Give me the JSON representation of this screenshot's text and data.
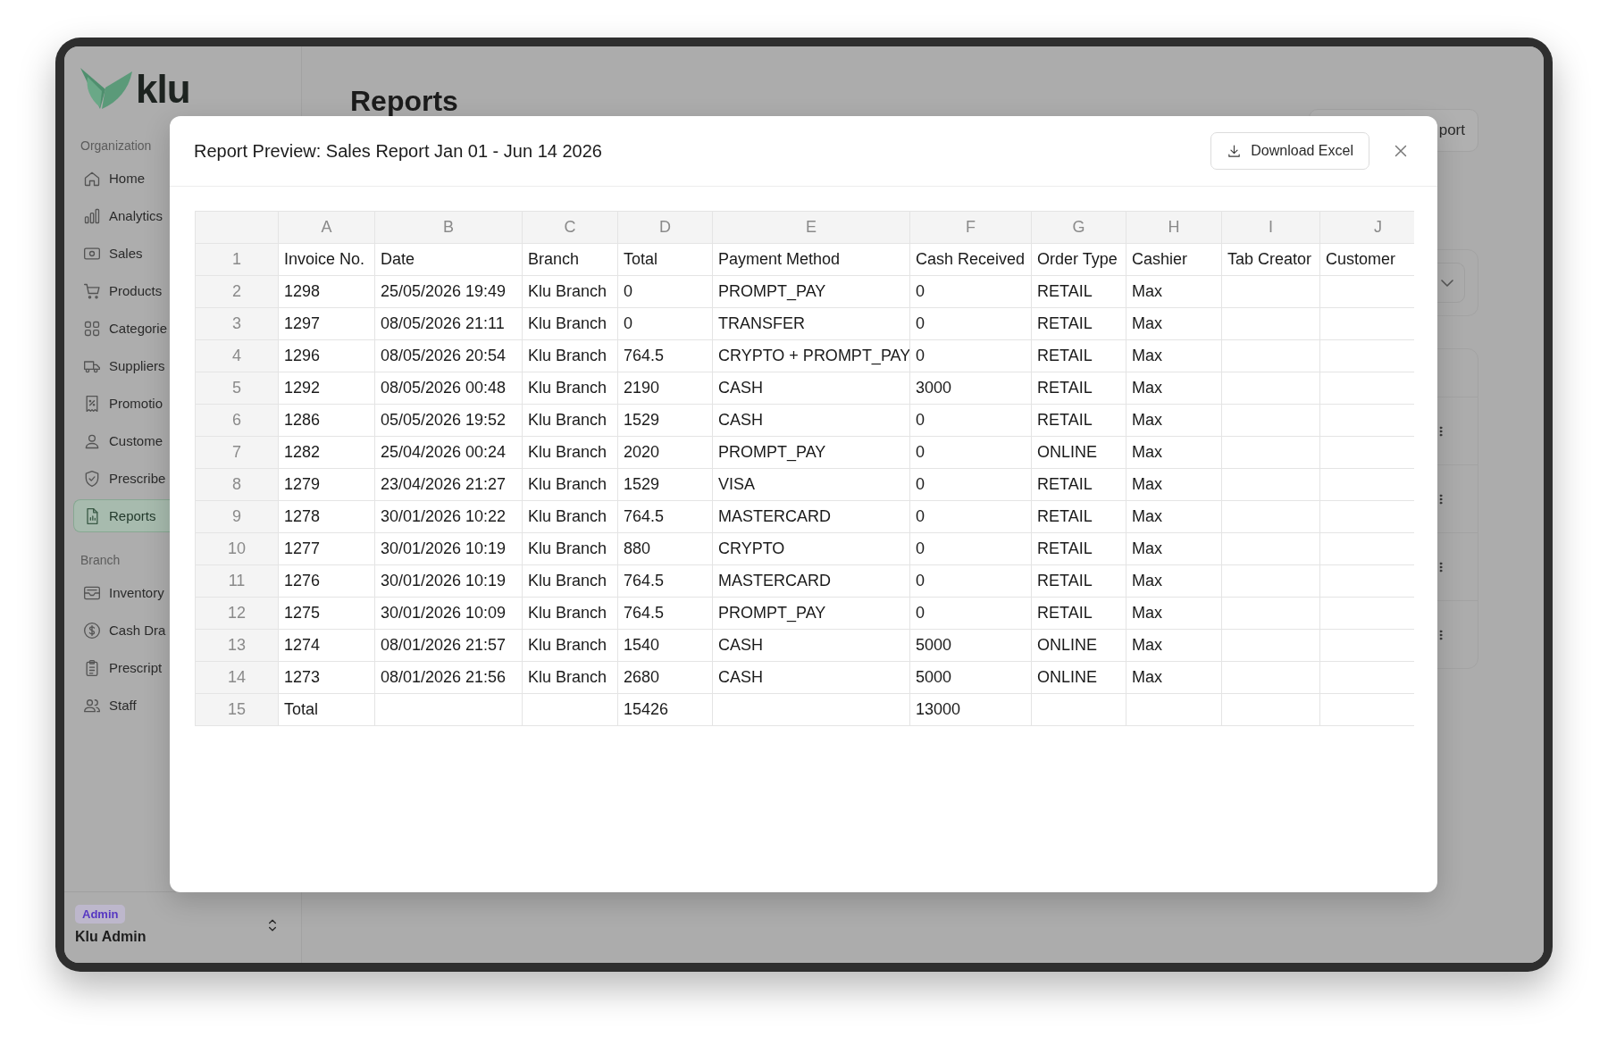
{
  "sidebar": {
    "logo": "klu",
    "sections": [
      {
        "heading": "Organization",
        "items": [
          {
            "label": "Home",
            "selected": false
          },
          {
            "label": "Analytics",
            "selected": false
          },
          {
            "label": "Sales",
            "selected": false
          },
          {
            "label": "Products",
            "selected": false
          },
          {
            "label": "Categorie",
            "selected": false
          },
          {
            "label": "Suppliers",
            "selected": false
          },
          {
            "label": "Promotio",
            "selected": false
          },
          {
            "label": "Custome",
            "selected": false
          },
          {
            "label": "Prescribe",
            "selected": false
          },
          {
            "label": "Reports",
            "selected": true
          }
        ]
      },
      {
        "heading": "Branch",
        "items": [
          {
            "label": "Inventory",
            "selected": false
          },
          {
            "label": "Cash Dra",
            "selected": false
          },
          {
            "label": "Prescript",
            "selected": false
          },
          {
            "label": "Staff",
            "selected": false
          }
        ]
      }
    ],
    "user": {
      "role": "Admin",
      "name": "Klu Admin"
    }
  },
  "page": {
    "title": "Reports",
    "action_button": "port"
  },
  "modal": {
    "title": "Report Preview: Sales Report Jan 01 - Jun 14 2026",
    "download_button": "Download Excel",
    "sheet": {
      "columns": [
        "A",
        "B",
        "C",
        "D",
        "E",
        "F",
        "G",
        "H",
        "I",
        "J"
      ],
      "rows": [
        {
          "number": "1",
          "cells": [
            "Invoice No.",
            "Date",
            "Branch",
            "Total",
            "Payment Method",
            "Cash Received",
            "Order Type",
            "Cashier",
            "Tab Creator",
            "Customer"
          ]
        },
        {
          "number": "2",
          "cells": [
            "1298",
            "25/05/2026 19:49",
            "Klu Branch",
            "0",
            "PROMPT_PAY",
            "0",
            "RETAIL",
            "Max"
          ]
        },
        {
          "number": "3",
          "cells": [
            "1297",
            "08/05/2026 21:11",
            "Klu Branch",
            "0",
            "TRANSFER",
            "0",
            "RETAIL",
            "Max"
          ]
        },
        {
          "number": "4",
          "cells": [
            "1296",
            "08/05/2026 20:54",
            "Klu Branch",
            "764.5",
            "CRYPTO + PROMPT_PAY",
            "0",
            "RETAIL",
            "Max"
          ]
        },
        {
          "number": "5",
          "cells": [
            "1292",
            "08/05/2026 00:48",
            "Klu Branch",
            "2190",
            "CASH",
            "3000",
            "RETAIL",
            "Max"
          ]
        },
        {
          "number": "6",
          "cells": [
            "1286",
            "05/05/2026 19:52",
            "Klu Branch",
            "1529",
            "CASH",
            "0",
            "RETAIL",
            "Max"
          ]
        },
        {
          "number": "7",
          "cells": [
            "1282",
            "25/04/2026 00:24",
            "Klu Branch",
            "2020",
            "PROMPT_PAY",
            "0",
            "ONLINE",
            "Max"
          ]
        },
        {
          "number": "8",
          "cells": [
            "1279",
            "23/04/2026 21:27",
            "Klu Branch",
            "1529",
            "VISA",
            "0",
            "RETAIL",
            "Max"
          ]
        },
        {
          "number": "9",
          "cells": [
            "1278",
            "30/01/2026 10:22",
            "Klu Branch",
            "764.5",
            "MASTERCARD",
            "0",
            "RETAIL",
            "Max"
          ]
        },
        {
          "number": "10",
          "cells": [
            "1277",
            "30/01/2026 10:19",
            "Klu Branch",
            "880",
            "CRYPTO",
            "0",
            "RETAIL",
            "Max"
          ]
        },
        {
          "number": "11",
          "cells": [
            "1276",
            "30/01/2026 10:19",
            "Klu Branch",
            "764.5",
            "MASTERCARD",
            "0",
            "RETAIL",
            "Max"
          ]
        },
        {
          "number": "12",
          "cells": [
            "1275",
            "30/01/2026 10:09",
            "Klu Branch",
            "764.5",
            "PROMPT_PAY",
            "0",
            "RETAIL",
            "Max"
          ]
        },
        {
          "number": "13",
          "cells": [
            "1274",
            "08/01/2026 21:57",
            "Klu Branch",
            "1540",
            "CASH",
            "5000",
            "ONLINE",
            "Max"
          ]
        },
        {
          "number": "14",
          "cells": [
            "1273",
            "08/01/2026 21:56",
            "Klu Branch",
            "2680",
            "CASH",
            "5000",
            "ONLINE",
            "Max"
          ]
        },
        {
          "number": "15",
          "cells": [
            "Total",
            null,
            null,
            "15426",
            null,
            "13000"
          ]
        }
      ]
    }
  }
}
